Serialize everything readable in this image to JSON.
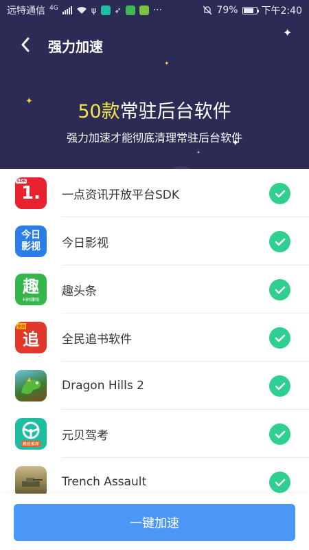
{
  "status_bar": {
    "carrier": "远特通信",
    "network": "4G",
    "battery": "79%",
    "battery_level": 0.79,
    "time": "下午2:40",
    "more": "···"
  },
  "header": {
    "title": "强力加速",
    "headline_count": "50款",
    "headline_text": "常驻后台软件",
    "subline": "强力加速才能彻底清理常驻后台软件"
  },
  "apps": [
    {
      "name": "一点资讯开放平台SDK",
      "icon": "yidian-icon"
    },
    {
      "name": "今日影视",
      "icon": "jinri-yingshi-icon"
    },
    {
      "name": "趣头条",
      "icon": "qutoutiao-icon"
    },
    {
      "name": "全民追书软件",
      "icon": "zhuishu-icon"
    },
    {
      "name": "Dragon Hills 2",
      "icon": "dragon-hills-icon"
    },
    {
      "name": "元贝驾考",
      "icon": "yuanbei-jiakao-icon"
    },
    {
      "name": "Trench Assault",
      "icon": "trench-assault-icon"
    }
  ],
  "icon_text": {
    "yidian_main": "1.",
    "yidian_tag": "SDK",
    "jinri_line1": "今日",
    "jinri_line2": "影视",
    "qu_main": "趣",
    "qu_sub": "扫码赚钱",
    "zhui_main": "追",
    "zhui_tag": "全民",
    "yuanbei_sub": "教练推荐"
  },
  "bottom": {
    "button_label": "一键加速"
  },
  "colors": {
    "header_bg": "#2b2b55",
    "accent_yellow": "#f5e44a",
    "check_green": "#2fcf8f",
    "button_blue": "#4b97f5"
  }
}
